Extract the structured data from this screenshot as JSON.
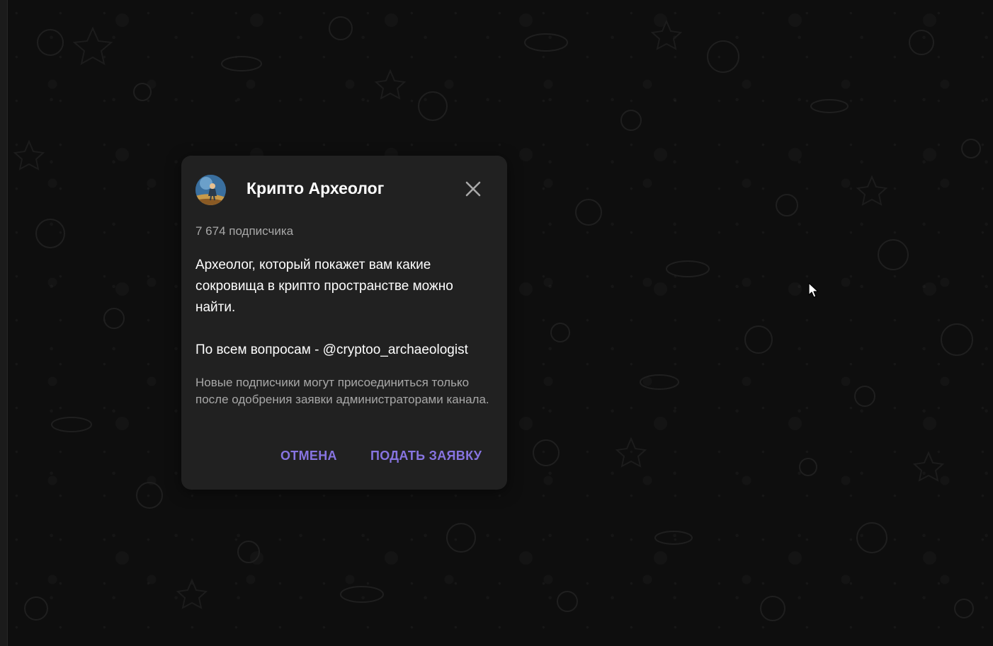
{
  "dialog": {
    "title": "Крипто Археолог",
    "subscribers": "7 674 подписчика",
    "description": "Археолог, который покажет вам какие сокровища в крипто пространстве можно найти.",
    "contact": "По всем вопросам - @cryptoo_archaeologist",
    "note": "Новые подписчики могут присоединиться только после одобрения заявки администраторами канала.",
    "cancel_label": "ОТМЕНА",
    "apply_label": "ПОДАТЬ ЗАЯВКУ",
    "close_icon": "close-icon",
    "avatar_icon": "channel-avatar"
  },
  "colors": {
    "background": "#0f0f0f",
    "dialog": "#212121",
    "accent": "#8774e1",
    "text_primary": "#ffffff",
    "text_secondary": "#a8a8a8"
  }
}
